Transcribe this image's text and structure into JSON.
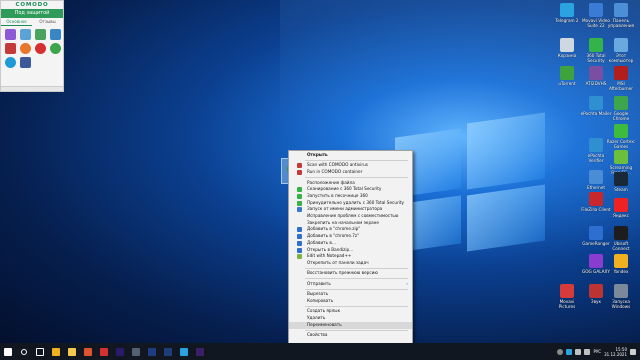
{
  "comodo": {
    "brand": "COMODO",
    "status": "Под защитой",
    "tabs": [
      "Основное",
      "Отзывы"
    ],
    "apps": [
      {
        "icon": "virus-scan-icon",
        "color": "#8e5bd6"
      },
      {
        "icon": "globe-icon",
        "color": "#5ba3d6"
      },
      {
        "icon": "shield-icon",
        "color": "#4aa35f"
      },
      {
        "icon": "container-icon",
        "color": "#3a86c4"
      },
      {
        "icon": "comodo-dragon-icon",
        "color": "#c43a3a"
      },
      {
        "icon": "firefox-icon",
        "color": "#e8762b"
      },
      {
        "icon": "opera-icon",
        "color": "#d63030"
      },
      {
        "icon": "chrome-icon",
        "color": "#3da54a"
      },
      {
        "icon": "skype-icon",
        "color": "#1e9bd7"
      },
      {
        "icon": "facebook-icon",
        "color": "#3b5998"
      }
    ]
  },
  "desktop_icons": [
    {
      "label": "Telegram 2",
      "icon": "telegram-icon",
      "color": "#2aa3e0"
    },
    {
      "label": "Movavi Video Suite 22",
      "icon": "movavi-icon",
      "color": "#3a7bd5"
    },
    {
      "label": "Панель управления",
      "icon": "control-panel-icon",
      "color": "#4d8fd6"
    },
    {
      "label": "Корзина",
      "icon": "recycle-bin-icon",
      "color": "#cfd8e0"
    },
    {
      "label": "360 Total Security",
      "icon": "360-security-icon",
      "color": "#33b34a"
    },
    {
      "label": "Этот компьютер",
      "icon": "this-pc-icon",
      "color": "#6aa8e0"
    },
    {
      "label": "uTorrent",
      "icon": "utorrent-icon",
      "color": "#3ea33e"
    },
    {
      "label": "ATI2DVHS",
      "icon": "ati-icon",
      "color": "#7a4ea0"
    },
    {
      "label": "MSI Afterburner",
      "icon": "msi-afterburner-icon",
      "color": "#b01e1e"
    },
    {
      "label": "ePochta Mailer",
      "icon": "epochta-mailer-icon",
      "color": "#2f8fd1"
    },
    {
      "label": "Google Chrome",
      "icon": "chrome-icon",
      "color": "#3da54a"
    },
    {
      "label": "Razer Cortex: Games",
      "icon": "razer-icon",
      "color": "#3dbb3d"
    },
    {
      "label": "ePochta Verifier",
      "icon": "epochta-verifier-icon",
      "color": "#2f8fd1"
    },
    {
      "label": "Screaming Frog SE...",
      "icon": "screaming-frog-icon",
      "color": "#6cbf3a"
    },
    {
      "label": "Ethernet",
      "icon": "ethernet-icon",
      "color": "#4a8dd6"
    },
    {
      "label": "Steam",
      "icon": "steam-icon",
      "color": "#1b2838"
    },
    {
      "label": "FileZilla Client",
      "icon": "filezilla-icon",
      "color": "#c8272d"
    },
    {
      "label": "Яндекс",
      "icon": "yandex-icon",
      "color": "#e22"
    },
    {
      "label": "GameRanger",
      "icon": "gameranger-icon",
      "color": "#2d6fd1"
    },
    {
      "label": "Ubisoft Connect",
      "icon": "ubisoft-icon",
      "color": "#1d1d1d"
    },
    {
      "label": "GOG GALAXY",
      "icon": "gog-icon",
      "color": "#8a3ccf"
    },
    {
      "label": "Yandex",
      "icon": "yandex-browser-icon",
      "color": "#f0b020"
    },
    {
      "label": "Movavi Pictures",
      "icon": "movavi-photo-icon",
      "color": "#d63a3a"
    },
    {
      "label": "Звук",
      "icon": "sound-icon",
      "color": "#b33"
    },
    {
      "label": "Запуска Windows",
      "icon": "windows-startup-icon",
      "color": "#7a8a9a"
    }
  ],
  "context_menu": [
    {
      "label": "Открыть",
      "bold": true,
      "icon": "",
      "color": ""
    },
    {
      "sep": true
    },
    {
      "label": "Scan with COMODO antivirus",
      "icon": "comodo-scan-icon",
      "color": "#c43a3a"
    },
    {
      "label": "Run in COMODO container",
      "icon": "comodo-container-icon",
      "color": "#c43a3a"
    },
    {
      "sep": true
    },
    {
      "label": "Расположение файла",
      "icon": "",
      "color": ""
    },
    {
      "label": "Сканирование с 360 Total Security",
      "icon": "360-scan-icon",
      "color": "#33b34a"
    },
    {
      "label": "Запустить в песочнице 360",
      "icon": "360-sandbox-icon",
      "color": "#33b34a"
    },
    {
      "label": "Принудительно удалить с 360 Total Security",
      "icon": "360-delete-icon",
      "color": "#33b34a"
    },
    {
      "label": "Запуск от имени администратора",
      "icon": "admin-shield-icon",
      "color": "#3a78d0"
    },
    {
      "label": "Исправление проблем с совместимостью",
      "icon": "",
      "color": ""
    },
    {
      "label": "Закрепить на начальном экране",
      "icon": "",
      "color": ""
    },
    {
      "label": "Добавить в \"chrome.zip\"",
      "icon": "archive-icon",
      "color": "#2f6fd0"
    },
    {
      "label": "Добавить в \"chrome.7z\"",
      "icon": "archive-icon",
      "color": "#2f6fd0"
    },
    {
      "label": "Добавить в...",
      "icon": "archive-icon",
      "color": "#2f6fd0"
    },
    {
      "label": "Открыть в Bandizip...",
      "icon": "bandizip-icon",
      "color": "#2f6fd0"
    },
    {
      "label": "Edit with Notepad++",
      "icon": "notepadpp-icon",
      "color": "#7cb342"
    },
    {
      "label": "Открепить от панели задач",
      "icon": "",
      "color": ""
    },
    {
      "sep": true
    },
    {
      "label": "Восстановить прежнюю версию",
      "icon": "",
      "color": ""
    },
    {
      "sep": true
    },
    {
      "label": "Отправить",
      "icon": "",
      "color": "",
      "submenu": true
    },
    {
      "sep": true
    },
    {
      "label": "Вырезать",
      "icon": "",
      "color": ""
    },
    {
      "label": "Копировать",
      "icon": "",
      "color": ""
    },
    {
      "sep": true
    },
    {
      "label": "Создать ярлык",
      "icon": "",
      "color": ""
    },
    {
      "label": "Удалить",
      "icon": "",
      "color": ""
    },
    {
      "label": "Переименовать",
      "icon": "",
      "color": "",
      "highlight": true
    },
    {
      "sep": true
    },
    {
      "label": "Свойства",
      "icon": "",
      "color": ""
    }
  ],
  "taskbar": {
    "items": [
      {
        "icon": "start-windows-icon",
        "color": "#ffffff"
      },
      {
        "icon": "search-icon",
        "color": "#ffffff"
      },
      {
        "icon": "task-view-icon",
        "color": "#ffffff"
      },
      {
        "icon": "yandex-browser-icon",
        "color": "#f0b020"
      },
      {
        "icon": "file-explorer-icon",
        "color": "#f2c94c"
      },
      {
        "icon": "brave-icon",
        "color": "#e0542f"
      },
      {
        "icon": "opera-icon",
        "color": "#d63030"
      },
      {
        "icon": "premiere-icon",
        "color": "#2a1a6a"
      },
      {
        "icon": "app-icon",
        "color": "#556070"
      },
      {
        "icon": "vegas-icon",
        "color": "#1f3d80"
      },
      {
        "icon": "photoshop-icon",
        "color": "#1e3d7a"
      },
      {
        "icon": "telegram-icon",
        "color": "#2aa3e0"
      },
      {
        "icon": "ae-icon",
        "color": "#3a1f6a"
      }
    ],
    "lang": "РУС",
    "time": "15:50",
    "date": "31.12.2021"
  }
}
